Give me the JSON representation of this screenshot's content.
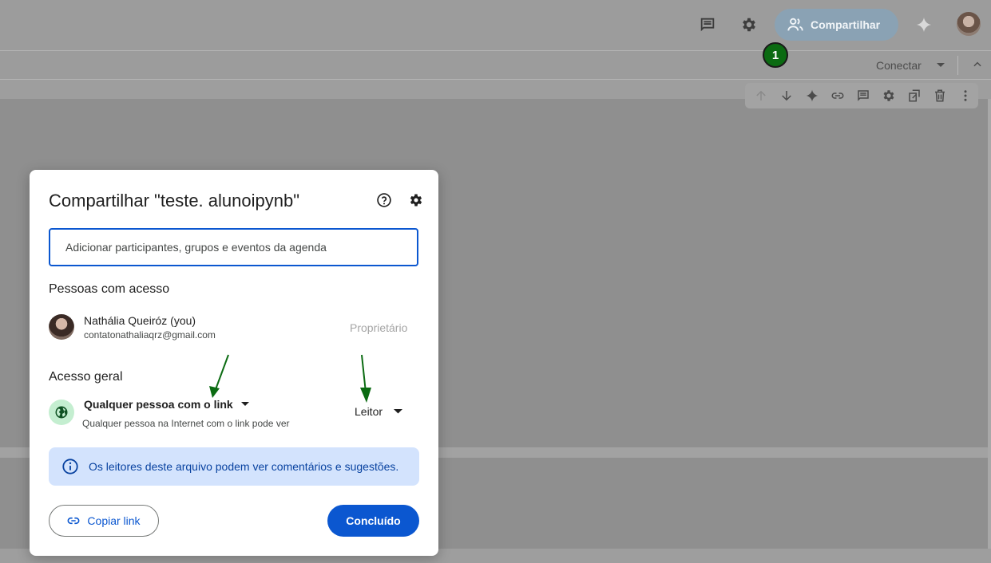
{
  "header": {
    "share_label": "Compartilhar",
    "step_badge": "1",
    "connect_label": "Conectar"
  },
  "icons": {
    "comments": "comment-icon",
    "settings": "gear-icon",
    "share": "people-icon",
    "gemini": "sparkle-icon",
    "avatar": "user-avatar"
  },
  "cell_toolbar": [
    {
      "name": "move-up-icon",
      "enabled": false
    },
    {
      "name": "move-down-icon",
      "enabled": true
    },
    {
      "name": "sparkle-icon",
      "enabled": true
    },
    {
      "name": "link-icon",
      "enabled": true
    },
    {
      "name": "comment-icon",
      "enabled": true
    },
    {
      "name": "gear-icon",
      "enabled": true
    },
    {
      "name": "mirror-cell-icon",
      "enabled": true
    },
    {
      "name": "trash-icon",
      "enabled": true
    },
    {
      "name": "more-vert-icon",
      "enabled": true
    }
  ],
  "dialog": {
    "title": "Compartilhar \"teste. alunoipynb\"",
    "input_placeholder": "Adicionar participantes, grupos e eventos da agenda",
    "people_heading": "Pessoas com acesso",
    "person": {
      "name": "Nathália Queiróz (you)",
      "email": "contatonathaliaqrz@gmail.com",
      "role": "Proprietário"
    },
    "general_heading": "Acesso geral",
    "access_option": "Qualquer pessoa com o link",
    "access_description": "Qualquer pessoa na Internet com o link pode ver",
    "role_option": "Leitor",
    "info_text": "Os leitores deste arquivo podem ver comentários e sugestões.",
    "copy_link_label": "Copiar link",
    "done_label": "Concluído"
  },
  "colors": {
    "primary": "#0b57d0",
    "info_bg": "#d3e3fd",
    "annotation_arrow": "#0b6b12"
  }
}
